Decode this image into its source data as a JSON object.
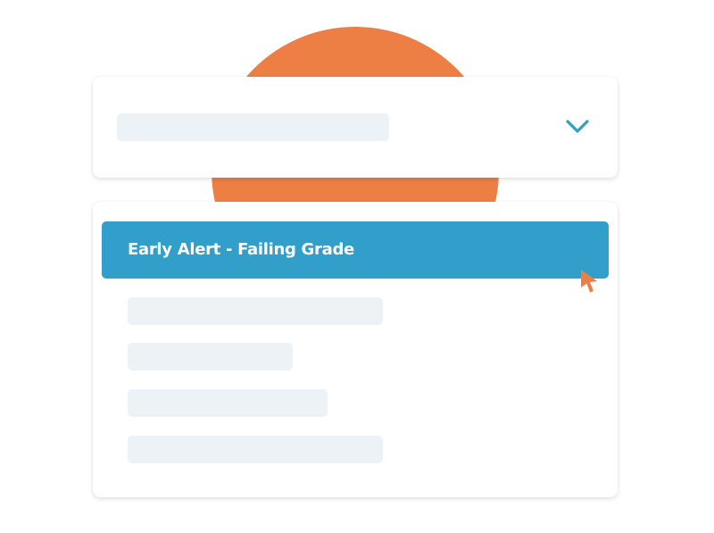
{
  "dropdown": {
    "toggle_icon": "chevron-down-icon",
    "accent_color": "#319fca"
  },
  "options": {
    "selected_label": "Early Alert - Failing Grade",
    "selected_bg": "#319fca"
  },
  "decor": {
    "circle_color": "#ed7f45",
    "cursor_icon": "mouse-pointer-icon"
  }
}
